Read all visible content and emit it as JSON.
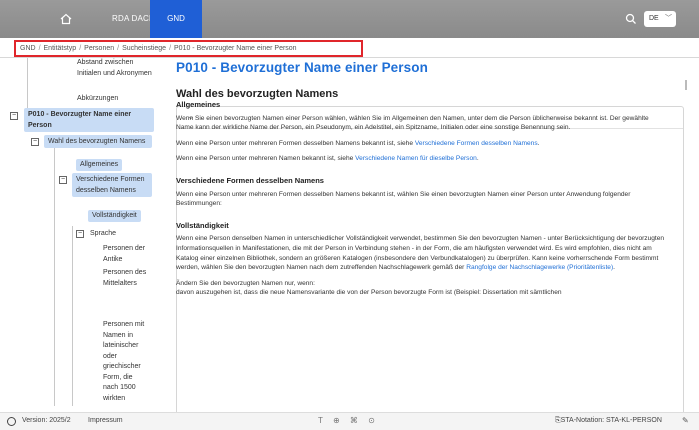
{
  "topbar": {
    "home_icon": "home-icon",
    "nav_rda": "RDA DACH",
    "nav_gnd": "GND",
    "search_icon": "search-icon",
    "language": "DE",
    "accent_color": "#1f5fd6"
  },
  "breadcrumb": {
    "items": [
      "GND",
      "Entitätstyp",
      "Personen",
      "Sucheinstiege",
      "P010 - Bevorzugter Name einer Person"
    ]
  },
  "sidebar": {
    "top_text": "Abstand zwischen Initialen und Akronymen",
    "abk": "Abkürzungen",
    "p010": "P010 - Bevorzugter Name einer Person",
    "wahl": "Wahl des bevorzugten Namens",
    "allgemeines": "Allgemeines",
    "verschiedene": "Verschiedene Formen desselben Namens",
    "vollstaendigkeit": "Vollständigkeit",
    "sprache": "Sprache",
    "antike": "Personen der Antike",
    "mittelalter": "Personen des Mittelalters",
    "namen": "Personen mit Namen in lateinischer oder griechischer Form, die nach 1500 wirkten",
    "toggle_minus": "⊟"
  },
  "main": {
    "title": "P010 - Bevorzugter Name einer Person",
    "section_heading": "Wahl des bevorzugten Namens",
    "allgemeines_h": "Allgemeines",
    "allgemeines_p1": "Wenn Sie einen bevorzugten Namen einer Person wählen, wählen Sie im Allgemeinen den Namen, unter dem die Person üblicherweise bekannt ist. Der gewählte Name kann der wirkliche Name der Person, ein Pseudonym, ein Adelstitel, ein Spitzname, Initialen oder eine sonstige Benennung sein.",
    "allgemeines_p2_pre": "Wenn eine Person unter mehreren Formen desselben Namens bekannt ist, siehe ",
    "allgemeines_p2_link": "Verschiedene Formen desselben Namens",
    "allgemeines_p2_post": ".",
    "allgemeines_p3_pre": "Wenn eine Person unter mehreren Namen bekannt ist, siehe ",
    "allgemeines_p3_link": "Verschiedene Namen für dieselbe Person",
    "allgemeines_p3_post": ".",
    "verschiedene_h": "Verschiedene Formen desselben Namens",
    "verschiedene_p": "Wenn eine Person unter mehreren Formen desselben Namens bekannt ist, wählen Sie einen bevorzugten Namen einer Person unter Anwendung folgender Bestimmungen:",
    "voll_h": "Vollständigkeit",
    "voll_p1_pre": "Wenn eine Person denselben Namen in unterschiedlicher Vollständigkeit verwendet, bestimmen Sie den bevorzugten Namen - unter Berücksichtigung der bevorzugten Informationsquellen in Manifestationen, die mit der Person in Verbindung stehen - in der Form, die am häufigsten verwendet wird. Es wird empfohlen, dies nicht am Katalog einer einzelnen Bibliothek, sondern an größeren Katalogen (insbesondere den Verbundkatalogen) zu überprüfen. Kann keine vorherrschende Form bestimmt werden, wählen Sie den bevorzugten Namen nach dem zutreffenden Nachschlagewerk gemäß der ",
    "voll_p1_link": "Rangfolge der Nachschlagewerke (Prioritätenliste)",
    "voll_p1_post": ".",
    "voll_p2": "Ändern Sie den bevorzugten Namen nur, wenn:",
    "voll_p3": "davon auszugehen ist, dass die neue Namensvariante die von der Person bevorzugte Form ist (Beispiel: Dissertation mit sämtlichen"
  },
  "footer": {
    "version": "Version: 2025/2",
    "impressum": "Impressum",
    "mid_icons": "T ⊕ ⌘ ⊙",
    "notation": "STA-Notation: STA-KL-PERSON"
  }
}
